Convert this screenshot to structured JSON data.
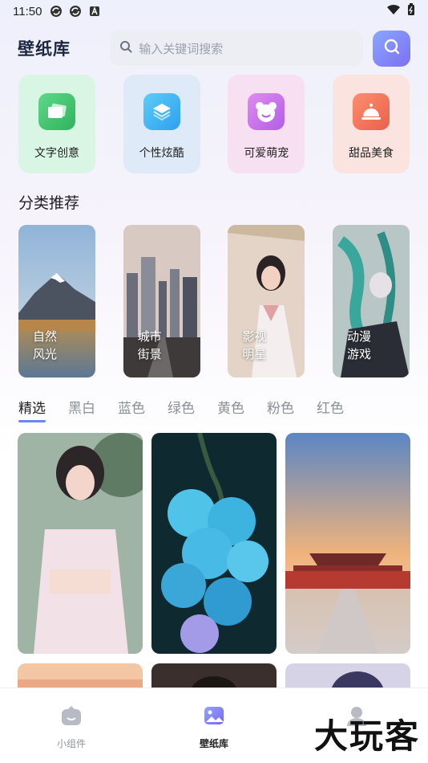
{
  "status_bar": {
    "time": "11:50"
  },
  "header": {
    "app_title": "壁纸库",
    "search_placeholder": "输入关键词搜索"
  },
  "quick_categories": [
    {
      "label": "文字创意",
      "bg": "#d9f5e3",
      "icon_color": "#3ec46a",
      "icon": "photos-icon"
    },
    {
      "label": "个性炫酷",
      "bg": "#dfeaf8",
      "icon_color": "#3fb4f2",
      "icon": "layers-icon"
    },
    {
      "label": "可爱萌宠",
      "bg": "#f7e0f2",
      "icon_color": "#c86be8",
      "icon": "bear-icon"
    },
    {
      "label": "甜品美食",
      "bg": "#fbe4df",
      "icon_color": "#f2745d",
      "icon": "cloche-icon"
    }
  ],
  "section_title": "分类推荐",
  "recommend_categories": [
    {
      "line1": "自然",
      "line2": "风光"
    },
    {
      "line1": "城市",
      "line2": "街景"
    },
    {
      "line1": "影视",
      "line2": "明星"
    },
    {
      "line1": "动漫",
      "line2": "游戏"
    }
  ],
  "tabs": [
    "精选",
    "黑白",
    "蓝色",
    "绿色",
    "黄色",
    "粉色",
    "红色"
  ],
  "active_tab": "精选",
  "bottom_nav": [
    {
      "label": "小组件",
      "icon": "widget-icon",
      "active": false
    },
    {
      "label": "壁纸库",
      "icon": "gallery-icon",
      "active": true
    },
    {
      "label": "",
      "icon": "profile-icon",
      "active": false
    }
  ],
  "watermark": "大玩客"
}
